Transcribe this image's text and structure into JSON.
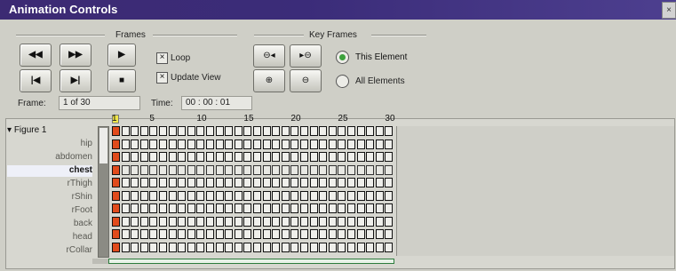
{
  "window": {
    "title": "Animation Controls",
    "close_label": "×"
  },
  "frames_group": {
    "label": "Frames",
    "buttons": [
      {
        "name": "rewind-button",
        "glyph": "◀◀"
      },
      {
        "name": "fast-forward-button",
        "glyph": "▶▶"
      },
      {
        "name": "play-button",
        "glyph": "▶"
      },
      {
        "name": "go-to-start-button",
        "glyph": "|◀"
      },
      {
        "name": "go-to-end-button",
        "glyph": "▶|"
      },
      {
        "name": "stop-button",
        "glyph": "■"
      }
    ],
    "loop_label": "Loop",
    "update_view_label": "Update View",
    "frame_label": "Frame:",
    "frame_value": "1 of 30",
    "time_label": "Time:",
    "time_value": "00 : 00 : 01"
  },
  "keyframes_group": {
    "label": "Key Frames",
    "buttons": [
      {
        "name": "prev-keyframe-button",
        "glyph": "⊖◂"
      },
      {
        "name": "next-keyframe-button",
        "glyph": "▸⊖"
      },
      {
        "name": "add-keyframe-button",
        "glyph": "⊕"
      },
      {
        "name": "delete-keyframe-button",
        "glyph": "⊖"
      }
    ],
    "this_element_label": "This Element",
    "all_elements_label": "All Elements"
  },
  "timeline": {
    "figure_label": "Figure 1",
    "tracks": [
      "hip",
      "abdomen",
      "chest",
      "rThigh",
      "rShin",
      "rFoot",
      "back",
      "head",
      "rCollar"
    ],
    "active_track": "chest",
    "ruler_labels": [
      "1",
      "5",
      "10",
      "15",
      "20",
      "25",
      "30"
    ]
  },
  "colors": {
    "titlebar": "#3c2a73",
    "keyframe_marker": "#e14b1c",
    "selection": "#2d7c3d"
  }
}
